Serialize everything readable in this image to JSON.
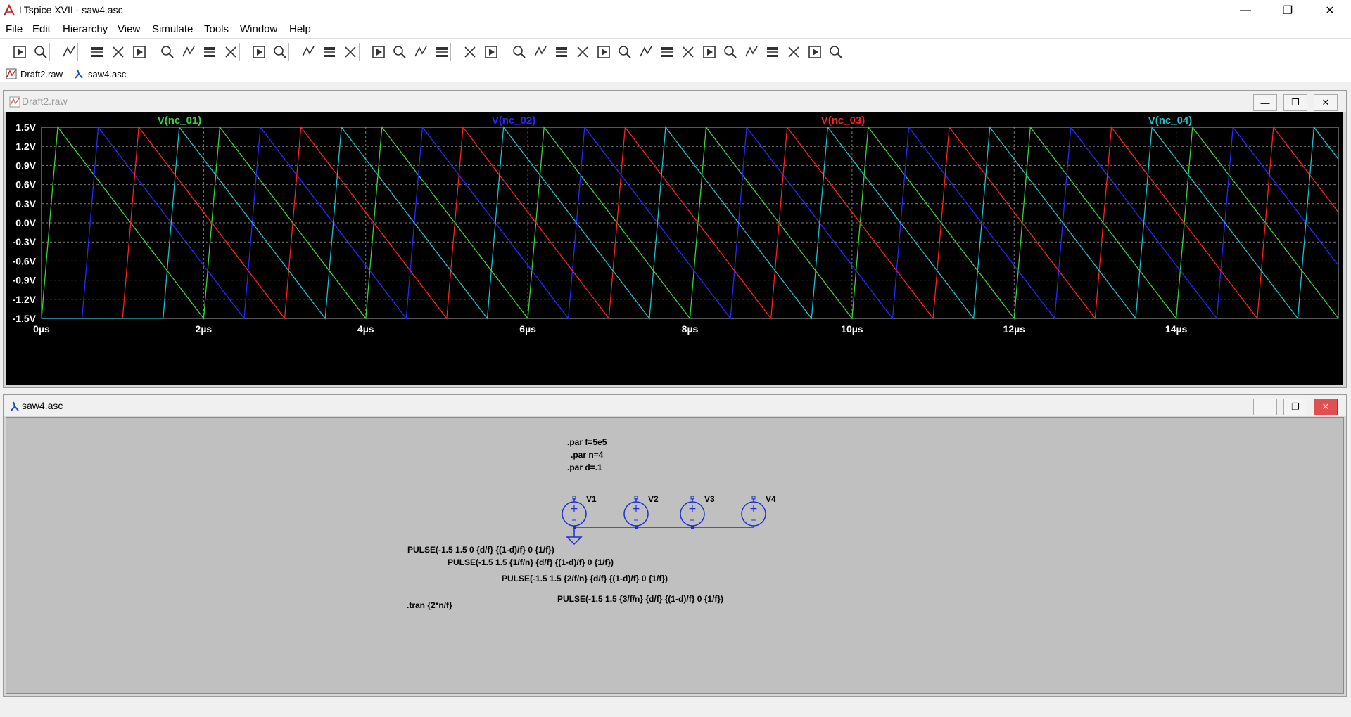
{
  "window": {
    "title": "LTspice XVII - saw4.asc",
    "minimize_glyph": "—",
    "maximize_glyph": "❐",
    "close_glyph": "✕"
  },
  "menu": [
    "File",
    "Edit",
    "Hierarchy",
    "View",
    "Simulate",
    "Tools",
    "Window",
    "Help"
  ],
  "toolbar_icons": [
    "run-icon",
    "open-icon",
    "save-icon",
    "control-panel-icon",
    "halt-icon",
    "pan-icon",
    "zoom-in-icon",
    "zoom-area-icon",
    "zoom-out-icon",
    "zoom-fit-icon",
    "autorange-icon",
    "cursor-icon",
    "tile-h-icon",
    "tile-v-icon",
    "cascade-icon",
    "cut-icon",
    "copy-icon",
    "paste-icon",
    "find-icon",
    "print-icon",
    "print-preview-icon",
    "draw-wire-icon",
    "ground-icon",
    "label-icon",
    "resistor-icon",
    "capacitor-icon",
    "inductor-icon",
    "diode-icon",
    "component-icon",
    "move-icon",
    "drag-icon",
    "undo-icon",
    "redo-icon",
    "rotate-icon",
    "mirror-icon",
    "text-icon",
    "spice-directive-icon"
  ],
  "doc_tabs": [
    {
      "label": "Draft2.raw",
      "icon": "waveform-icon"
    },
    {
      "label": "saw4.asc",
      "icon": "schematic-icon"
    }
  ],
  "waveform": {
    "title": "Draft2.raw"
  },
  "schematic": {
    "title": "saw4.asc",
    "directives": [
      ".par f=5e5",
      ".par n=4",
      ".par d=.1",
      ".tran {2*n/f}"
    ],
    "sources": [
      "V1",
      "V2",
      "V3",
      "V4"
    ],
    "pulses": [
      "PULSE(-1.5 1.5 0 {d/f} {(1-d)/f} 0 {1/f})",
      "PULSE(-1.5 1.5 {1/f/n} {d/f} {(1-d)/f} 0 {1/f})",
      "PULSE(-1.5 1.5 {2/f/n} {d/f} {(1-d)/f} 0 {1/f})",
      "PULSE(-1.5 1.5 {3/f/n} {d/f} {(1-d)/f} 0 {1/f})"
    ]
  },
  "chart_data": {
    "type": "line",
    "title": "",
    "xlabel": "",
    "ylabel": "",
    "xlim": [
      0,
      16
    ],
    "ylim": [
      -1.5,
      1.5
    ],
    "x_unit": "µs",
    "grid": true,
    "legend": "top",
    "xticks": [
      "0µs",
      "2µs",
      "4µs",
      "6µs",
      "8µs",
      "10µs",
      "12µs",
      "14µs"
    ],
    "yticks": [
      "1.5V",
      "1.2V",
      "0.9V",
      "0.6V",
      "0.3V",
      "0.0V",
      "-0.3V",
      "-0.6V",
      "-0.9V",
      "-1.2V",
      "-1.5V"
    ],
    "period": 2,
    "rise": 0.2,
    "series": [
      {
        "name": "V(nc_01)",
        "delay": 0,
        "color": "#3cd23c"
      },
      {
        "name": "V(nc_02)",
        "delay": 0.5,
        "color": "#2828ff"
      },
      {
        "name": "V(nc_03)",
        "delay": 1.0,
        "color": "#ff2020"
      },
      {
        "name": "V(nc_04)",
        "delay": 1.5,
        "color": "#20c0c8"
      }
    ],
    "colors": {
      "background": "#000000",
      "axis_text": "#ffffff",
      "grid": "#7a7a7a"
    }
  }
}
